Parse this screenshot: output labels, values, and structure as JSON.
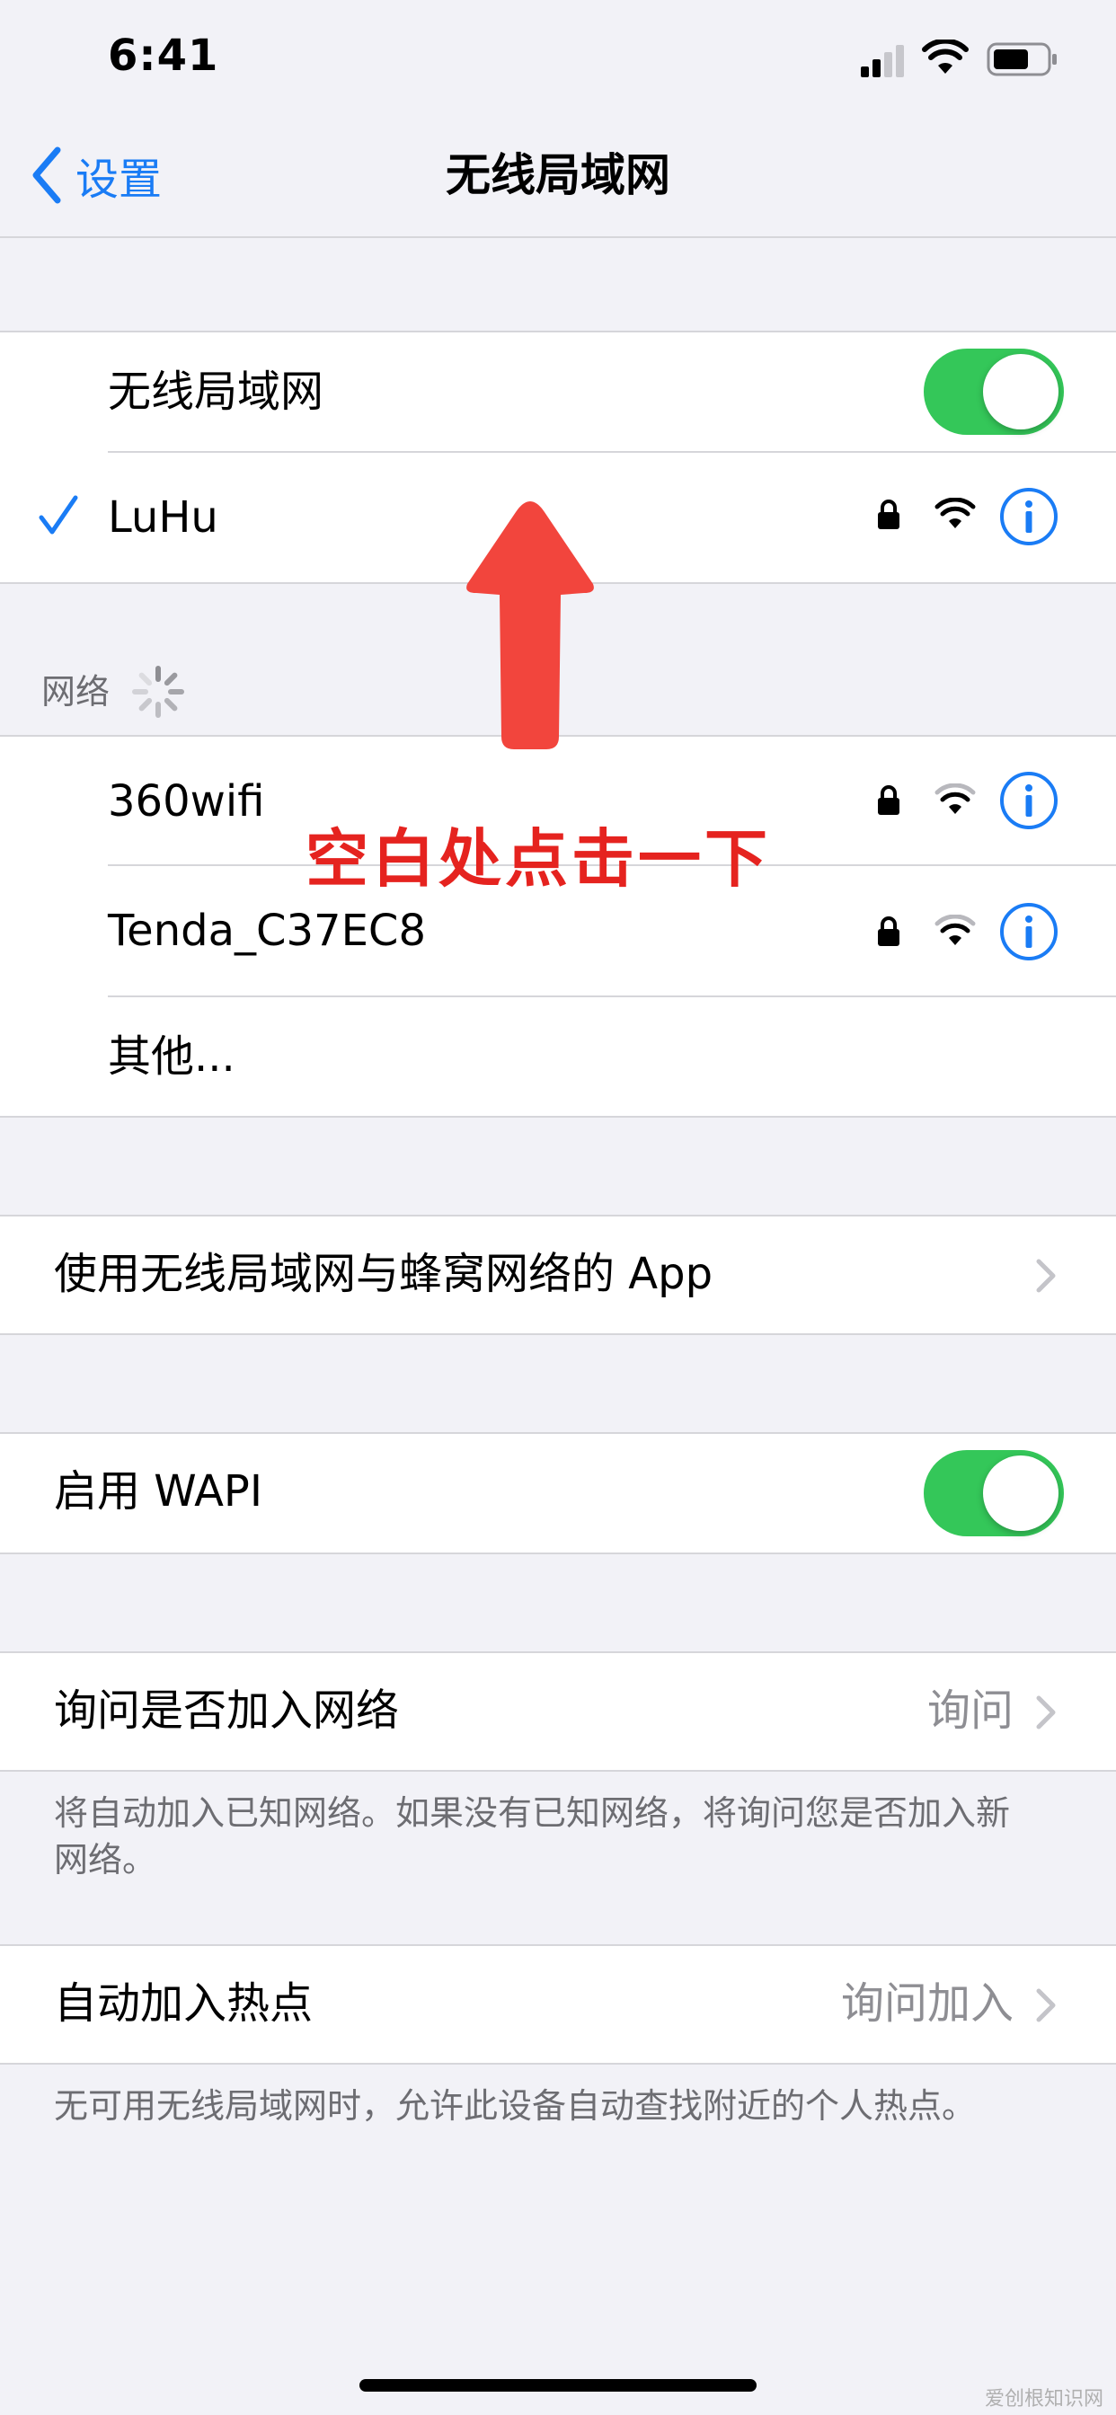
{
  "status_bar": {
    "time": "6:41"
  },
  "nav": {
    "back_label": "设置",
    "title": "无线局域网"
  },
  "wifi_section": {
    "toggle_label": "无线局域网",
    "toggle_on": true,
    "connected_network": "LuHu"
  },
  "networks_section": {
    "header": "网络",
    "networks": [
      {
        "name": "360wifi",
        "secured": true
      },
      {
        "name": "Tenda_C37EC8",
        "secured": true
      }
    ],
    "other_label": "其他..."
  },
  "apps_row": {
    "label": "使用无线局域网与蜂窝网络的 App"
  },
  "wapi_row": {
    "label": "启用 WAPI",
    "toggle_on": true
  },
  "ask_join_row": {
    "label": "询问是否加入网络",
    "value": "询问",
    "footer": "将自动加入已知网络。如果没有已知网络，将询问您是否加入新网络。"
  },
  "auto_hotspot_row": {
    "label": "自动加入热点",
    "value": "询问加入",
    "footer": "无可用无线局域网时，允许此设备自动查找附近的个人热点。"
  },
  "annotation": {
    "text": "空白处点击一下"
  },
  "watermark": "爱创根知识网",
  "colors": {
    "accent": "#1a7cf5",
    "toggle_on": "#34c759",
    "annotation_red": "#e5231f",
    "background": "#f2f2f7"
  }
}
